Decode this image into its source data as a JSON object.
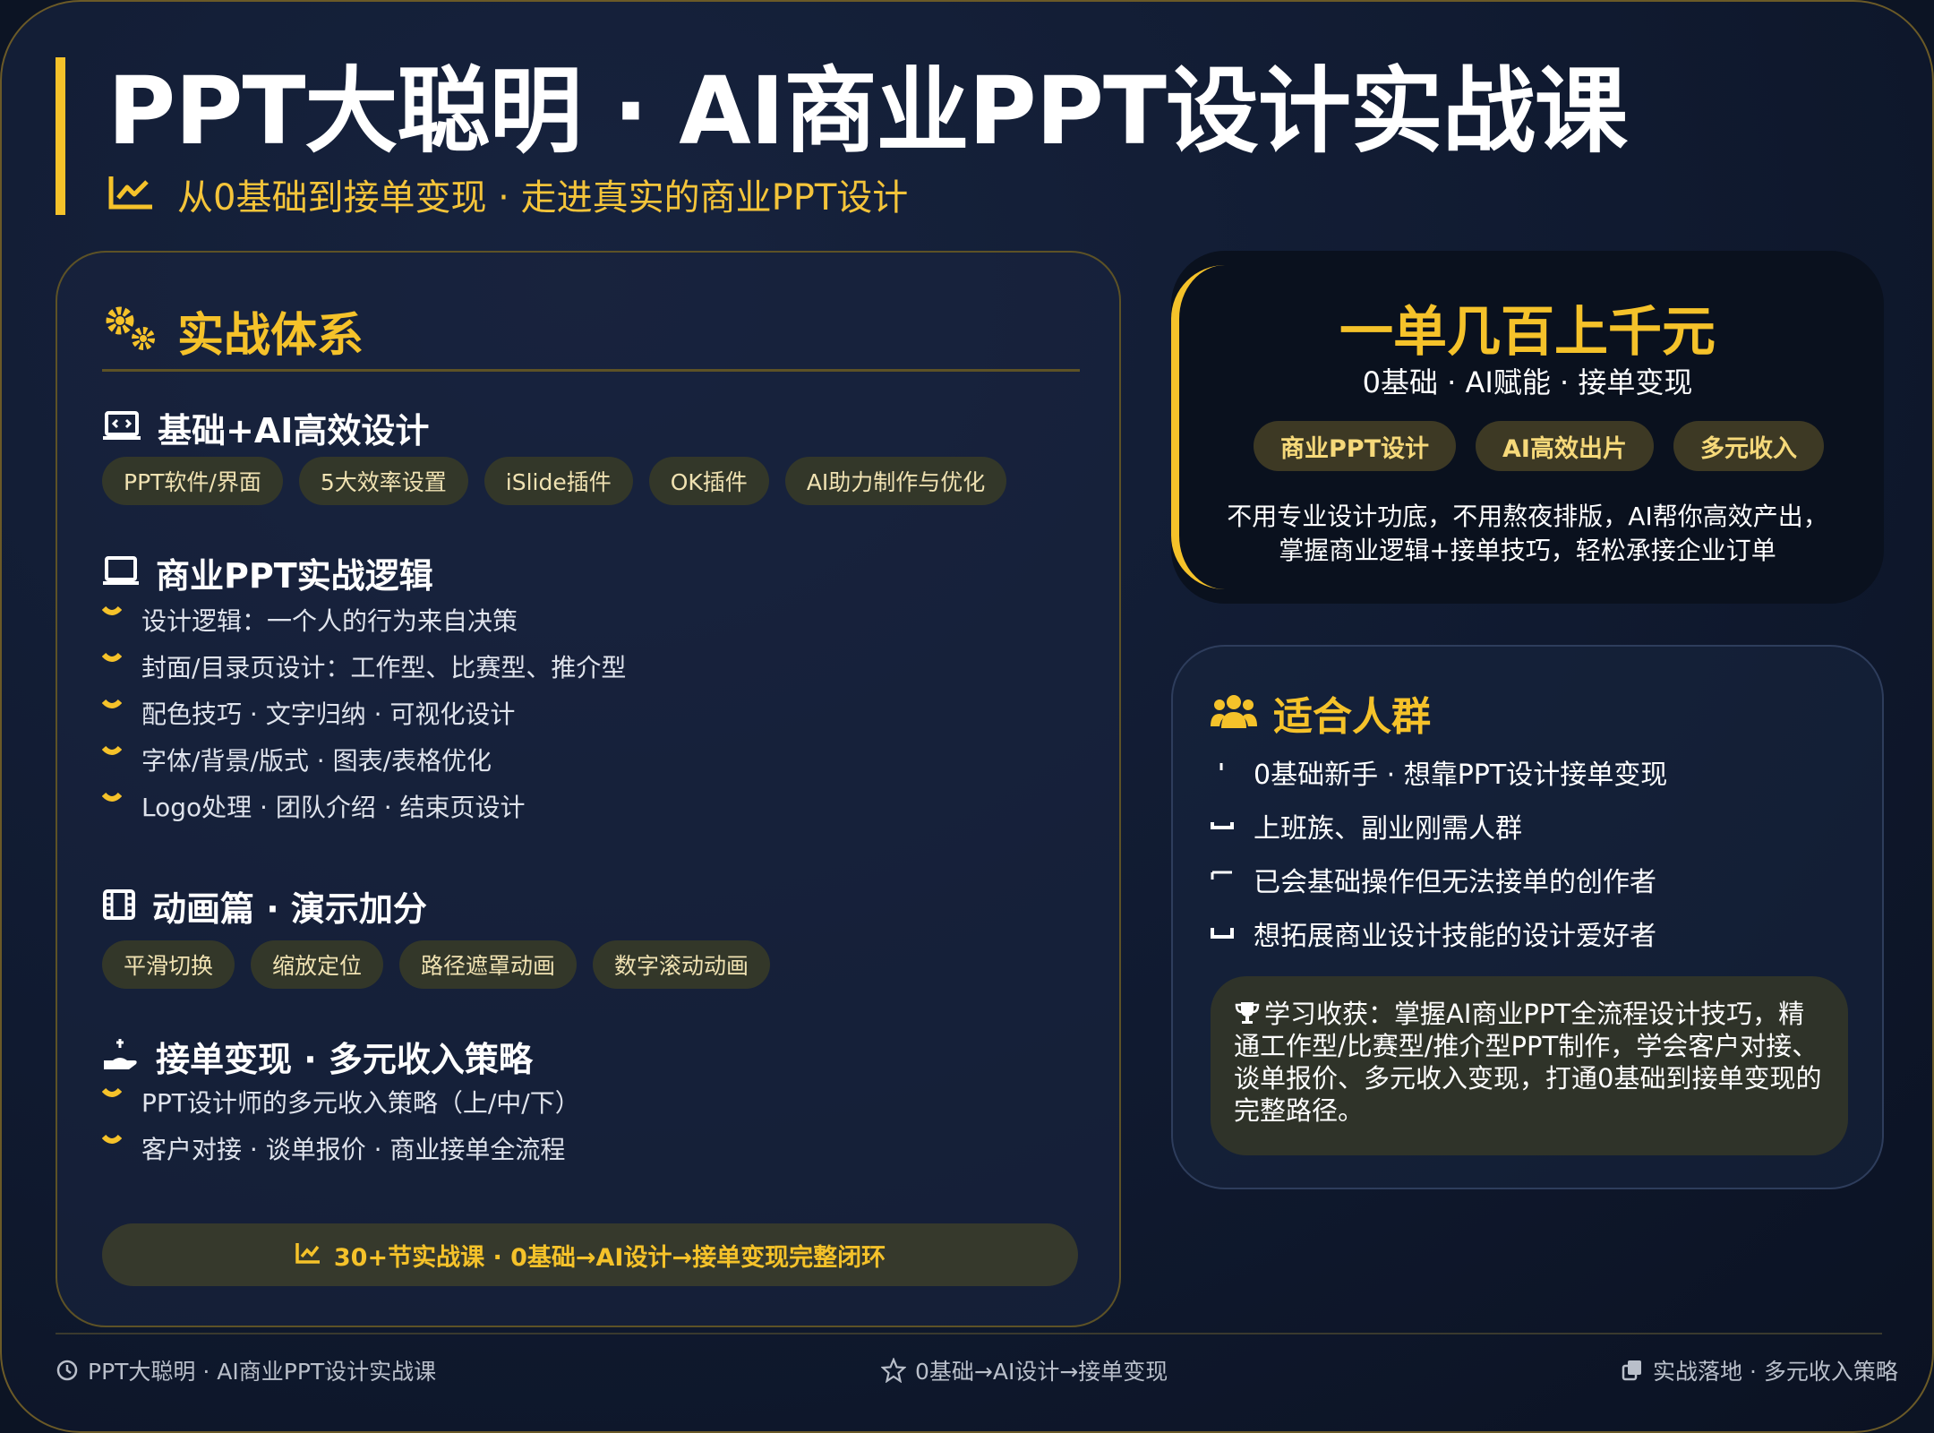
{
  "header": {
    "title": "PPT大聪明 · AI商业PPT设计实战课",
    "subtitle": "从0基础到接单变现 · 走进真实的商业PPT设计"
  },
  "system": {
    "title": "实战体系",
    "basic": {
      "title": "基础+AI高效设计",
      "chips": [
        "PPT软件/界面",
        "5大效率设置",
        "iSlide插件",
        "OK插件",
        "AI助力制作与优化"
      ]
    },
    "logic": {
      "title": "商业PPT实战逻辑",
      "items": [
        "设计逻辑：一个人的行为来自决策",
        "封面/目录页设计：工作型、比赛型、推介型",
        "配色技巧 · 文字归纳 · 可视化设计",
        "字体/背景/版式 · 图表/表格优化",
        "Logo处理 · 团队介绍 · 结束页设计"
      ]
    },
    "anim": {
      "title": "动画篇 · 演示加分",
      "chips": [
        "平滑切换",
        "缩放定位",
        "路径遮罩动画",
        "数字滚动动画"
      ]
    },
    "income": {
      "title": "接单变现 · 多元收入策略",
      "items": [
        "PPT设计师的多元收入策略（上/中/下）",
        "客户对接 · 谈单报价 · 商业接单全流程"
      ]
    },
    "footer": "30+节实战课 · 0基础→AI设计→接单变现完整闭环"
  },
  "hero": {
    "title": "一单几百上千元",
    "subtitle": "0基础 · AI赋能 · 接单变现",
    "chips": [
      "商业PPT设计",
      "AI高效出片",
      "多元收入"
    ],
    "desc_line1": "不用专业设计功底，不用熬夜排版，AI帮你高效产出，",
    "desc_line2": "掌握商业逻辑+接单技巧，轻松承接企业订单"
  },
  "audience": {
    "title": "适合人群",
    "items": [
      "0基础新手 · 想靠PPT设计接单变现",
      "上班族、副业刚需人群",
      "已会基础操作但无法接单的创作者",
      "想拓展商业设计技能的设计爱好者"
    ],
    "gain": "学习收获：掌握AI商业PPT全流程设计技巧，精通工作型/比赛型/推介型PPT制作，学会客户对接、谈单报价、多元收入变现，打通0基础到接单变现的完整路径。"
  },
  "footer": {
    "left": "PPT大聪明 · AI商业PPT设计实战课",
    "center": "0基础→AI设计→接单变现",
    "right": "实战落地 · 多元收入策略"
  },
  "colors": {
    "accent": "#f5c22a",
    "background": "#101a30",
    "chip": "#333729"
  },
  "icons": [
    "chart-line-icon",
    "gears-icon",
    "laptop-code-icon",
    "laptop-icon",
    "film-icon",
    "hand-coin-icon",
    "users-icon",
    "trophy-icon",
    "clock-icon",
    "star-icon",
    "copy-icon"
  ]
}
